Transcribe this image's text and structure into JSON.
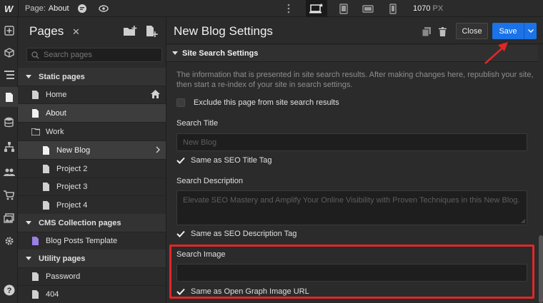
{
  "topbar": {
    "page_prefix": "Page:",
    "page_name": "About",
    "zoom_value": "1070",
    "zoom_unit": "PX",
    "icons": [
      "webflow-logo",
      "comments-icon",
      "preview-eye-icon",
      "more-vertical-icon",
      "desktop-icon",
      "tablet-icon",
      "mobile-landscape-icon",
      "mobile-portrait-icon"
    ]
  },
  "pages_panel": {
    "title": "Pages",
    "close_glyph": "✕",
    "search_placeholder": "Search pages",
    "groups": {
      "static": "Static pages",
      "cms": "CMS Collection pages",
      "utility": "Utility pages"
    },
    "items": {
      "home": "Home",
      "about": "About",
      "work": "Work",
      "new_blog": "New Blog",
      "project2": "Project 2",
      "project3": "Project 3",
      "project4": "Project 4",
      "blog_posts_template": "Blog Posts Template",
      "password": "Password",
      "not_found": "404"
    }
  },
  "settings": {
    "title": "New Blog Settings",
    "close_label": "Close",
    "save_label": "Save",
    "section_title": "Site Search Settings",
    "description": "The information that is presented in site search results. After making changes here, republish your site, then start a re-index of your site in search settings.",
    "exclude_label": "Exclude this page from site search results",
    "search_title_label": "Search Title",
    "search_title_placeholder": "New Blog",
    "same_as_seo_title": "Same as SEO Title Tag",
    "search_description_label": "Search Description",
    "search_description_placeholder": "Elevate SEO Mastery and Amplify Your Online Visibility with Proven Techniques in this New Blog.",
    "same_as_seo_description": "Same as SEO Description Tag",
    "search_image_label": "Search Image",
    "search_image_value": "",
    "same_as_og_image": "Same as Open Graph Image URL"
  },
  "colors": {
    "accent_blue": "#1a73e8",
    "highlight_red": "#e12626",
    "panel_bg": "#2b2b2b",
    "cms_icon": "#9b7fe6"
  }
}
